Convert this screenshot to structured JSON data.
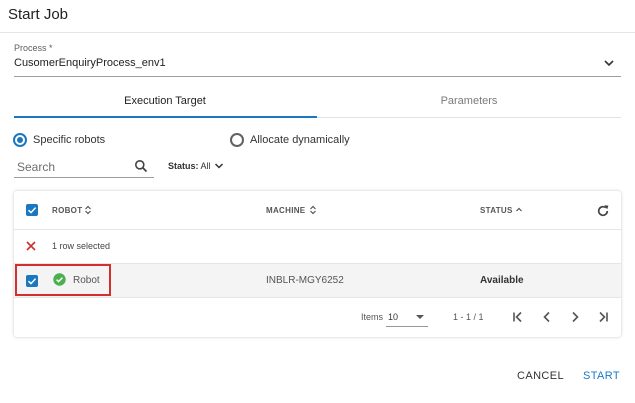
{
  "dialog": {
    "title": "Start Job"
  },
  "process": {
    "label": "Process *",
    "value": "CusomerEnquiryProcess_env1"
  },
  "tabs": [
    {
      "label": "Execution Target",
      "active": true
    },
    {
      "label": "Parameters",
      "active": false
    }
  ],
  "allocation": {
    "options": [
      {
        "label": "Specific robots",
        "selected": true
      },
      {
        "label": "Allocate dynamically",
        "selected": false
      }
    ]
  },
  "filters": {
    "search_placeholder": "Search",
    "status_label": "Status:",
    "status_value": "All"
  },
  "table": {
    "columns": [
      "ROBOT",
      "MACHINE",
      "STATUS"
    ],
    "selection_text": "1 row selected",
    "rows": [
      {
        "robot": "Robot",
        "machine": "INBLR-MGY6252",
        "status": "Available",
        "checked": true
      }
    ]
  },
  "pagination": {
    "items_label": "Items",
    "page_size": "10",
    "range": "1 - 1 / 1"
  },
  "actions": {
    "cancel": "CANCEL",
    "start": "START"
  },
  "colors": {
    "accent": "#1a78c2",
    "highlight": "#d32f2f",
    "available": "#4caf50"
  }
}
